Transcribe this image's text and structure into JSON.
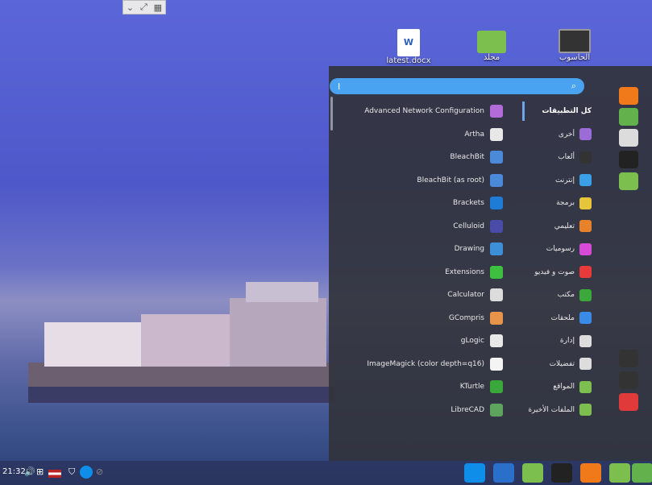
{
  "desktop": {
    "icons": [
      {
        "label": "latest.docx",
        "icon": "word-doc-icon"
      },
      {
        "label": "مجلد",
        "icon": "folder-icon"
      },
      {
        "label": "الحاسوب",
        "icon": "computer-icon"
      }
    ]
  },
  "menu": {
    "search": {
      "value": "I",
      "icon": "search-icon"
    },
    "apps": [
      {
        "label": "Advanced Network Configuration",
        "color": "#b26bd8"
      },
      {
        "label": "Artha",
        "color": "#e8e8e8"
      },
      {
        "label": "BleachBit",
        "color": "#4a8ad8"
      },
      {
        "label": "BleachBit (as root)",
        "color": "#4a8ad8"
      },
      {
        "label": "Brackets",
        "color": "#1e7bd6"
      },
      {
        "label": "Celluloid",
        "color": "#4a4aa8"
      },
      {
        "label": "Drawing",
        "color": "#3d8fd8"
      },
      {
        "label": "Extensions",
        "color": "#3fbf3f"
      },
      {
        "label": "Calculator",
        "color": "#dcdcdc"
      },
      {
        "label": "GCompris",
        "color": "#e8944a"
      },
      {
        "label": "gLogic",
        "color": "#e8e8e8"
      },
      {
        "label": "ImageMagick (color depth=q16)",
        "color": "#f4f4f4"
      },
      {
        "label": "KTurtle",
        "color": "#3ba83b"
      },
      {
        "label": "LibreCAD",
        "color": "#5ea45e"
      }
    ],
    "categories": [
      {
        "label": "كل التطبيقات",
        "color": ""
      },
      {
        "label": "أخرى",
        "color": "#9b6bd8"
      },
      {
        "label": "ألعاب",
        "color": "#333333"
      },
      {
        "label": "إنترنت",
        "color": "#3aa0e8"
      },
      {
        "label": "برمجة",
        "color": "#e8c43a"
      },
      {
        "label": "تعليمي",
        "color": "#e8822a"
      },
      {
        "label": "رسوميات",
        "color": "#d84ad8"
      },
      {
        "label": "صوت و فيديو",
        "color": "#e83a3a"
      },
      {
        "label": "مكتب",
        "color": "#3aa83a"
      },
      {
        "label": "ملحقات",
        "color": "#3a8ae8"
      },
      {
        "label": "إدارة",
        "color": "#dddddd"
      },
      {
        "label": "تفضيلات",
        "color": "#dddddd"
      },
      {
        "label": "المواقع",
        "color": "#7cbf4e"
      },
      {
        "label": "الملفات الأخيرة",
        "color": "#7cbf4e"
      }
    ],
    "favorites": [
      {
        "name": "firefox-icon",
        "color": "#f07a1a"
      },
      {
        "name": "software-manager-icon",
        "color": "#62b14c"
      },
      {
        "name": "settings-toggle-icon",
        "color": "#dcdcdc"
      },
      {
        "name": "terminal-icon",
        "color": "#222222"
      },
      {
        "name": "files-folder-icon",
        "color": "#7cbf4e"
      },
      {
        "name": "lock-screen-icon",
        "color": "#333333"
      },
      {
        "name": "logout-icon",
        "color": "#333333"
      },
      {
        "name": "shutdown-icon",
        "color": "#e03a3a"
      }
    ]
  },
  "panel": {
    "clock": "21:32",
    "tray": [
      "volume-icon",
      "network-icon",
      "us-flag-icon",
      "shield-icon",
      "teamviewer-icon",
      "update-icon"
    ],
    "tasks": [
      "teamviewer-icon",
      "camera-icon",
      "folder-icon",
      "terminal-icon",
      "firefox-icon",
      "folder-icon",
      "mint-menu-icon"
    ]
  }
}
